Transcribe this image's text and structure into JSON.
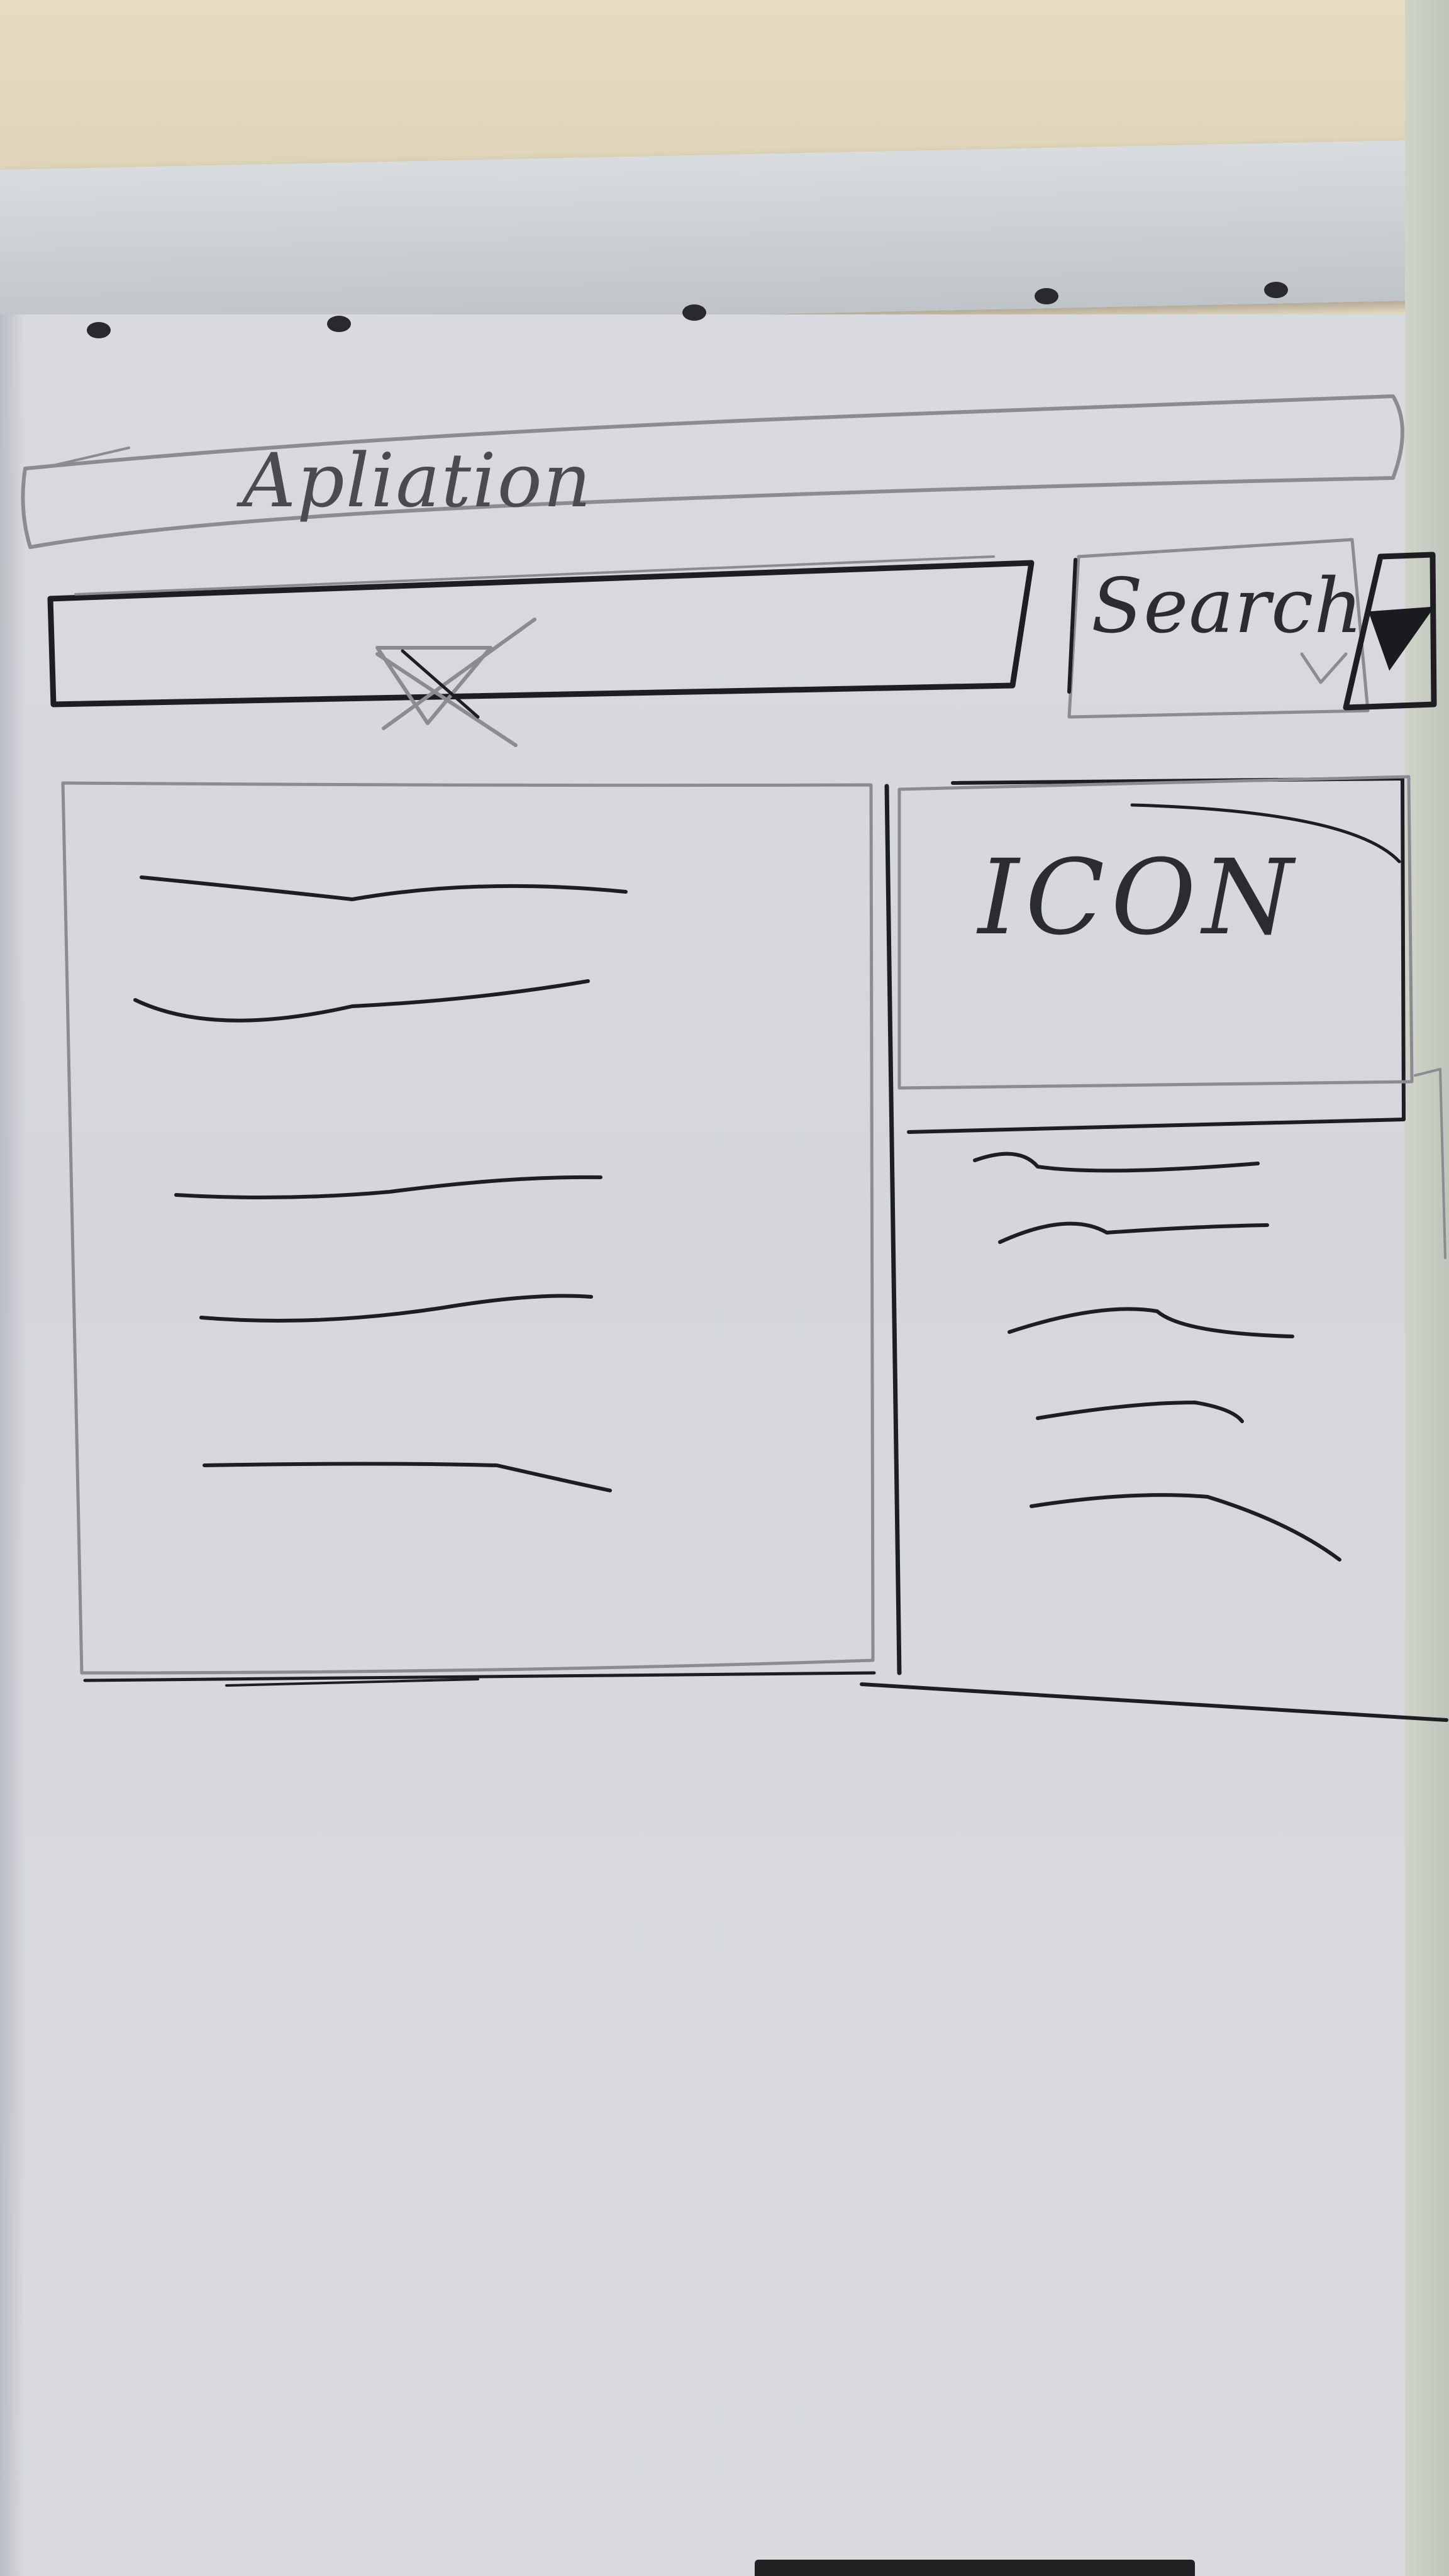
{
  "header": {
    "title": "Apliation"
  },
  "search": {
    "button_label": "Search"
  },
  "sidebar": {
    "icon_label": "ICON"
  }
}
